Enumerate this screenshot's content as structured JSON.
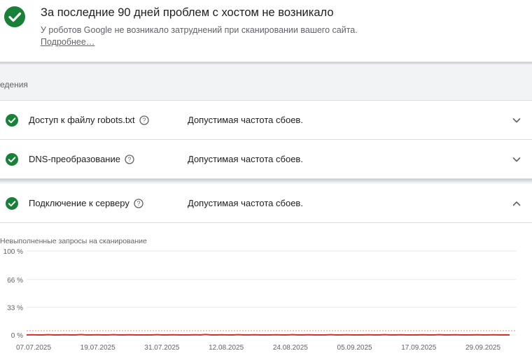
{
  "summary": {
    "title": "За последние 90 дней проблем с хостом не возникало",
    "description": "У роботов Google не возникало затруднений при сканировании вашего сайта.",
    "more_link": "Подробнее…"
  },
  "section": {
    "label": "едения"
  },
  "rows": [
    {
      "name": "Доступ к файлу robots.txt",
      "status": "Допустимая частота сбоев.",
      "expanded": false
    },
    {
      "name": "DNS-преобразование",
      "status": "Допустимая частота сбоев.",
      "expanded": false
    },
    {
      "name": "Подключение к серверу",
      "status": "Допустимая частота сбоев.",
      "expanded": true
    }
  ],
  "colors": {
    "success": "#188038",
    "line": "#d93025",
    "threshold": "#e8a59f",
    "grid": "#e8eaed"
  },
  "icons": {
    "check": "check-circle-icon",
    "help": "help-circle-icon",
    "expand": "chevron-down-icon",
    "collapse": "chevron-up-icon"
  },
  "chart_data": {
    "type": "line",
    "title": "Невыполненные запросы на сканирование",
    "xlabel": "",
    "ylabel": "",
    "yticks": [
      "0 %",
      "33 %",
      "66 %",
      "100 %"
    ],
    "ytick_values": [
      0,
      33,
      66,
      100
    ],
    "ylim": [
      0,
      100
    ],
    "xticks": [
      "07.07.2025",
      "19.07.2025",
      "31.07.2025",
      "12.08.2025",
      "24.08.2025",
      "05.09.2025",
      "17.09.2025",
      "29.09.2025"
    ],
    "threshold": 5,
    "grid": true,
    "series": [
      {
        "values": [
          0,
          0.2,
          0,
          0,
          0.3,
          0,
          0,
          0.2,
          0,
          0,
          0.4,
          0,
          0,
          0.2,
          0,
          0,
          0.3,
          0,
          0,
          0.2,
          0,
          0,
          0,
          0,
          0.3,
          0,
          0,
          0.2,
          0,
          0,
          0,
          0.2,
          0,
          0.5,
          0,
          0,
          0.2,
          0,
          0,
          0.3,
          0,
          0,
          0.2,
          0,
          0,
          0,
          0.2,
          0,
          0,
          0.3,
          0,
          0,
          0.2,
          0,
          0,
          0,
          0.3,
          0,
          0,
          0.2,
          0,
          0,
          0,
          0.2,
          0,
          0,
          0.3,
          0,
          0,
          0.2,
          0,
          0,
          0,
          0.2,
          0,
          0,
          0.3,
          0,
          0,
          0.2,
          0,
          0,
          0,
          0.2,
          0,
          0,
          0.2,
          0,
          0.1,
          0
        ]
      }
    ]
  }
}
